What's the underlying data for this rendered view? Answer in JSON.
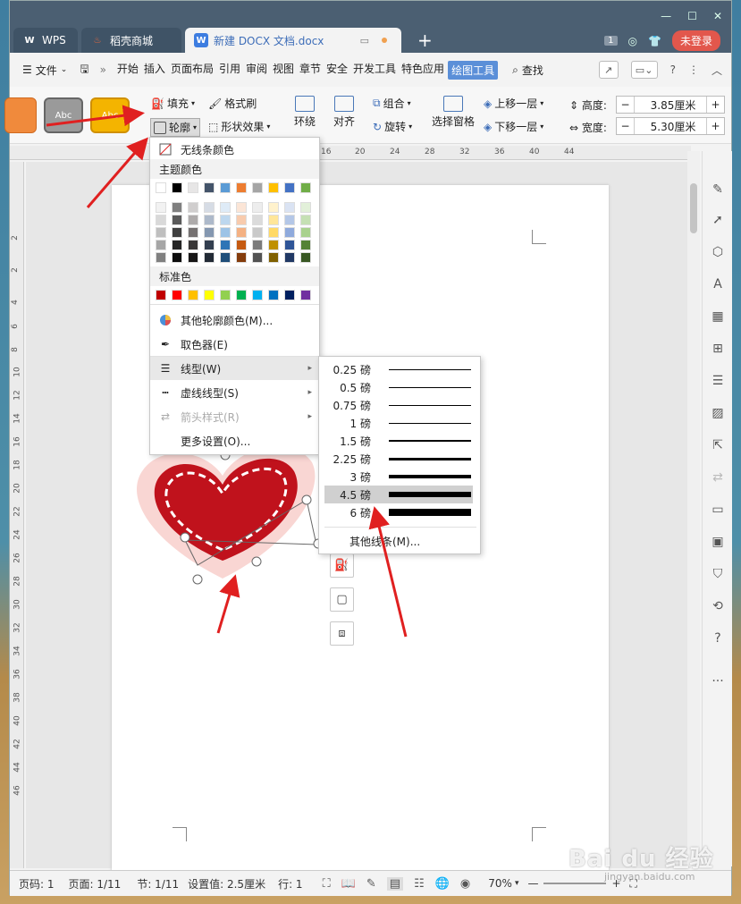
{
  "titlebar": {
    "tabs": [
      {
        "label": "WPS",
        "icon": "wps-logo-icon"
      },
      {
        "label": "稻壳商城",
        "icon": "daoke-flame-icon"
      },
      {
        "label": "新建 DOCX 文档.docx",
        "icon": "doc-icon"
      }
    ],
    "badge": "1",
    "login": "未登录"
  },
  "menubar": {
    "file": "文件",
    "tabs": [
      "开始",
      "插入",
      "页面布局",
      "引用",
      "审阅",
      "视图",
      "章节",
      "安全",
      "开发工具",
      "特色应用",
      "绘图工具"
    ],
    "active_tab": "绘图工具",
    "find": "查找"
  },
  "ribbon": {
    "styles": [
      "Abc",
      "Abc"
    ],
    "fill": "填充",
    "format_painter": "格式刷",
    "outline": "轮廓",
    "shape_effects": "形状效果",
    "wrap": "环绕",
    "align": "对齐",
    "group": "组合",
    "rotate": "旋转",
    "selection_pane": "选择窗格",
    "bring_forward": "上移一层",
    "send_backward": "下移一层",
    "height_label": "高度:",
    "height_value": "3.85厘米",
    "width_label": "宽度:",
    "width_value": "5.30厘米"
  },
  "ruler": {
    "h_ticks": [
      "16",
      "20",
      "24",
      "28",
      "32",
      "36",
      "40",
      "44"
    ],
    "v_ticks": [
      "2",
      "2",
      "4",
      "6",
      "8",
      "10",
      "12",
      "14",
      "16",
      "18",
      "20",
      "22",
      "24",
      "26",
      "28",
      "30",
      "32",
      "34",
      "36",
      "38",
      "40",
      "42",
      "44",
      "46"
    ]
  },
  "outline_menu": {
    "no_line": "无线条颜色",
    "theme_colors": "主题颜色",
    "standard_colors": "标准色",
    "theme_row": [
      "#ffffff",
      "#000000",
      "#e7e6e6",
      "#44546a",
      "#5b9bd5",
      "#ed7d31",
      "#a5a5a5",
      "#ffc000",
      "#4472c4",
      "#70ad47"
    ],
    "shade_cols": [
      [
        "#f2f2f2",
        "#d9d9d9",
        "#bfbfbf",
        "#a6a6a6",
        "#808080"
      ],
      [
        "#7f7f7f",
        "#595959",
        "#3f3f3f",
        "#262626",
        "#0d0d0d"
      ],
      [
        "#d0cece",
        "#aeabab",
        "#757171",
        "#3a3838",
        "#171616"
      ],
      [
        "#d6dce5",
        "#adb9ca",
        "#8497b0",
        "#333f50",
        "#222a35"
      ],
      [
        "#deebf7",
        "#bdd7ee",
        "#9dc3e6",
        "#2e75b6",
        "#1f4e79"
      ],
      [
        "#fbe5d6",
        "#f8cbad",
        "#f4b183",
        "#c55a11",
        "#843c0c"
      ],
      [
        "#ededed",
        "#dbdbdb",
        "#c9c9c9",
        "#7b7b7b",
        "#525252"
      ],
      [
        "#fff2cc",
        "#ffe699",
        "#ffd966",
        "#bf9000",
        "#7f6000"
      ],
      [
        "#dae3f3",
        "#b4c7e7",
        "#8faadc",
        "#2f5597",
        "#203864"
      ],
      [
        "#e2f0d9",
        "#c5e0b4",
        "#a9d18e",
        "#548235",
        "#385723"
      ]
    ],
    "standard_row": [
      "#c00000",
      "#ff0000",
      "#ffc000",
      "#ffff00",
      "#92d050",
      "#00b050",
      "#00b0f0",
      "#0070c0",
      "#002060",
      "#7030a0"
    ],
    "other_colors": "其他轮廓颜色(M)...",
    "eyedropper": "取色器(E)",
    "line_type": "线型(W)",
    "dash_type": "虚线线型(S)",
    "arrow_style": "箭头样式(R)",
    "more_settings": "更多设置(O)..."
  },
  "linetype_menu": {
    "items": [
      {
        "label": "0.25 磅",
        "weight": 0.25
      },
      {
        "label": "0.5 磅",
        "weight": 0.5
      },
      {
        "label": "0.75 磅",
        "weight": 0.75
      },
      {
        "label": "1 磅",
        "weight": 1
      },
      {
        "label": "1.5 磅",
        "weight": 1.5
      },
      {
        "label": "2.25 磅",
        "weight": 2.25
      },
      {
        "label": "3 磅",
        "weight": 3
      },
      {
        "label": "4.5 磅",
        "weight": 4.5
      },
      {
        "label": "6 磅",
        "weight": 6
      }
    ],
    "selected": "4.5 磅",
    "more": "其他线条(M)..."
  },
  "statusbar": {
    "page_num": "页码: 1",
    "pages": "页面: 1/11",
    "section": "节: 1/11",
    "setting": "设置值: 2.5厘米",
    "row": "行: 1",
    "zoom": "70%"
  },
  "colors": {
    "accent": "#5b8fd8",
    "annotation_arrow": "#e02020",
    "heart_red": "#c0121c",
    "heart_glow": "#f7c5c0"
  },
  "watermark": {
    "brand": "Bai du 经验",
    "url": "jingyan.baidu.com"
  }
}
